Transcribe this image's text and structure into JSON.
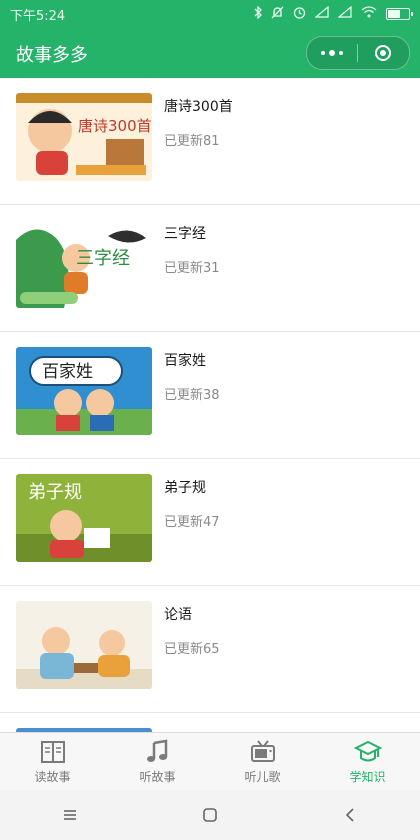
{
  "status_bar": {
    "time": "下午5:24",
    "icons": [
      "bluetooth-icon",
      "mute-icon",
      "alarm-icon",
      "signal-icon",
      "signal-icon",
      "wifi-icon",
      "battery-icon"
    ]
  },
  "nav": {
    "title": "故事多多",
    "capsule": {
      "more_icon": "more-dots-icon",
      "close_icon": "close-circle-icon"
    }
  },
  "list": {
    "items": [
      {
        "title": "唐诗300首",
        "subtitle": "已更新81",
        "cover_text": "唐诗300首",
        "cover_accent": "#e9a23b"
      },
      {
        "title": "三字经",
        "subtitle": "已更新31",
        "cover_text": "三字经",
        "cover_accent": "#3b9a4b"
      },
      {
        "title": "百家姓",
        "subtitle": "已更新38",
        "cover_text": "百家姓",
        "cover_accent": "#2f8fd0"
      },
      {
        "title": "弟子规",
        "subtitle": "已更新47",
        "cover_text": "弟子规",
        "cover_accent": "#8fb33a"
      },
      {
        "title": "论语",
        "subtitle": "已更新65",
        "cover_text": "",
        "cover_accent": "#7ab6d6"
      }
    ]
  },
  "tab_bar": {
    "tabs": [
      {
        "label": "读故事",
        "icon": "book-icon",
        "active": false
      },
      {
        "label": "听故事",
        "icon": "music-note-icon",
        "active": false
      },
      {
        "label": "听儿歌",
        "icon": "tv-icon",
        "active": false
      },
      {
        "label": "学知识",
        "icon": "graduation-cap-icon",
        "active": true
      }
    ]
  },
  "system_nav": {
    "buttons": [
      "menu-icon",
      "home-icon",
      "back-icon"
    ]
  },
  "colors": {
    "brand": "#25b36a",
    "active_tab": "#25b36a",
    "inactive_tab": "#7a7a7a"
  }
}
